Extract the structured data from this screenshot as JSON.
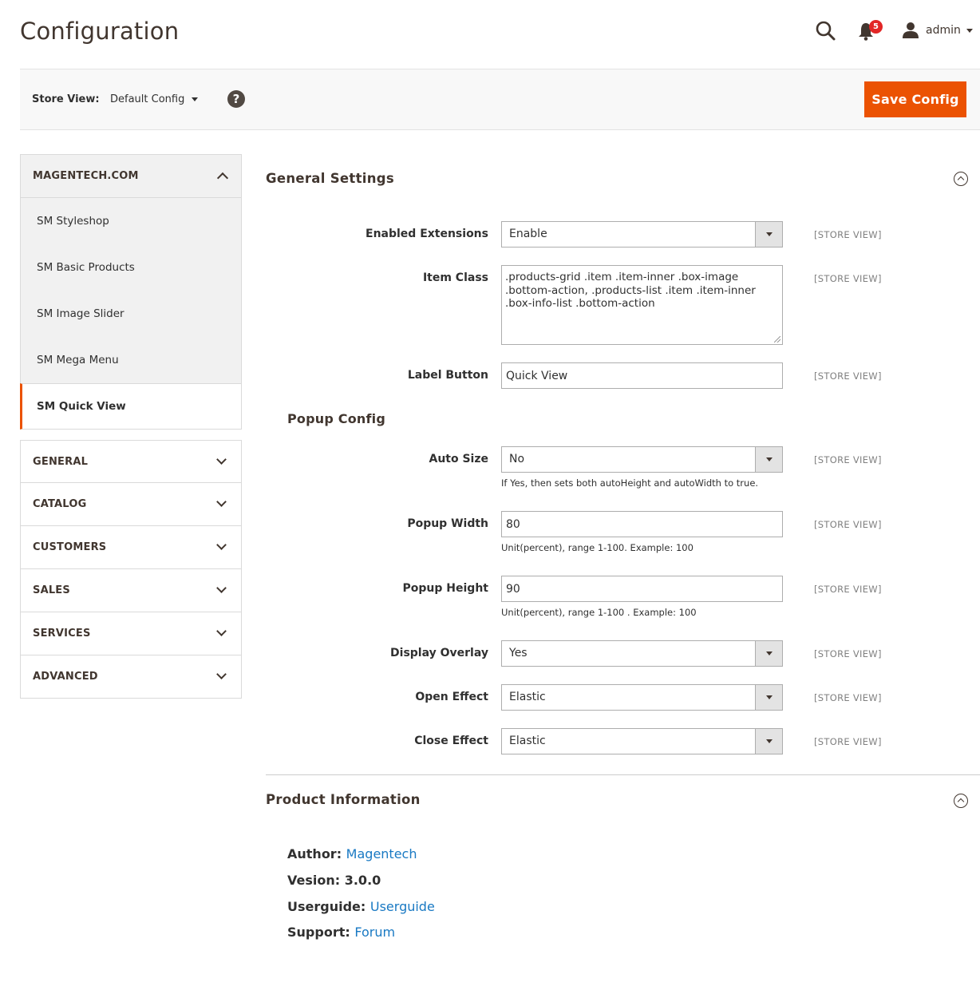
{
  "header": {
    "page_title": "Configuration",
    "notifications_count": "5",
    "admin_name": "admin"
  },
  "store_bar": {
    "label": "Store View:",
    "selected": "Default Config",
    "help": "?",
    "save_label": "Save Config"
  },
  "sidebar": {
    "magentech": {
      "title": "MAGENTECH.COM",
      "items": [
        "SM Styleshop",
        "SM Basic Products",
        "SM Image Slider",
        "SM Mega Menu",
        "SM Quick View"
      ],
      "active_index": 4
    },
    "sections": [
      "GENERAL",
      "CATALOG",
      "CUSTOMERS",
      "SALES",
      "SERVICES",
      "ADVANCED"
    ]
  },
  "general_settings": {
    "title": "General Settings",
    "scope": "[STORE VIEW]",
    "enabled_extensions": {
      "label": "Enabled Extensions",
      "value": "Enable"
    },
    "item_class": {
      "label": "Item Class",
      "value": ".products-grid .item .item-inner .box-image .bottom-action, .products-list .item .item-inner .box-info-list .bottom-action"
    },
    "label_button": {
      "label": "Label Button",
      "value": "Quick View"
    },
    "popup_config": "Popup Config",
    "auto_size": {
      "label": "Auto Size",
      "value": "No",
      "note": "If Yes, then sets both autoHeight and autoWidth to true."
    },
    "popup_width": {
      "label": "Popup Width",
      "value": "80",
      "note": "Unit(percent), range 1-100. Example: 100"
    },
    "popup_height": {
      "label": "Popup Height",
      "value": "90",
      "note": "Unit(percent), range 1-100 . Example: 100"
    },
    "display_overlay": {
      "label": "Display Overlay",
      "value": "Yes"
    },
    "open_effect": {
      "label": "Open Effect",
      "value": "Elastic"
    },
    "close_effect": {
      "label": "Close Effect",
      "value": "Elastic"
    }
  },
  "product_info": {
    "title": "Product Information",
    "author_key": "Author:",
    "author_link": "Magentech",
    "version_text": "Vesion: 3.0.0",
    "userguide_key": "Userguide:",
    "userguide_link": "Userguide",
    "support_key": "Support:",
    "support_link": "Forum"
  },
  "colors": {
    "accent": "#eb5202",
    "link": "#1979c3",
    "badge": "#e22626"
  }
}
